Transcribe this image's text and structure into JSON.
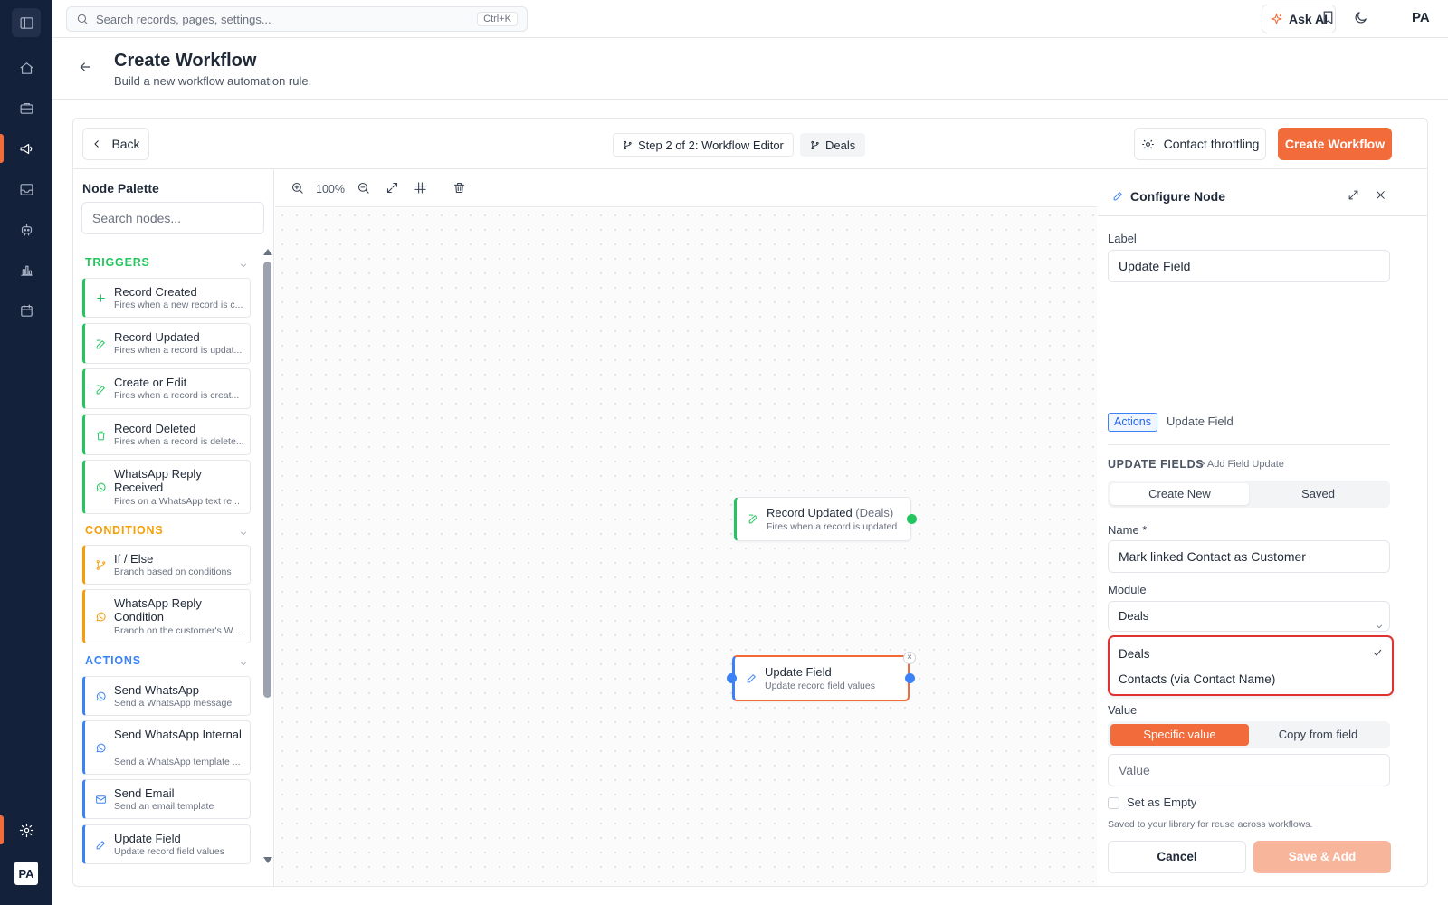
{
  "app": {
    "search_placeholder": "Search records, pages, settings...",
    "search_shortcut": "Ctrl+K",
    "ask_ai_label": "Ask AI",
    "user_initials": "PA",
    "accent_color": "#f26b3a",
    "rail_icons": [
      "sidebar-toggle-icon",
      "home-icon",
      "briefcase-icon",
      "megaphone-icon",
      "inbox-icon",
      "bot-icon",
      "bar-chart-icon",
      "calendar-icon",
      "gear-icon"
    ]
  },
  "page": {
    "title": "Create Workflow",
    "subtitle": "Build a new workflow automation rule."
  },
  "toolbar": {
    "back_label": "Back",
    "step_label": "Step 2 of 2: Workflow Editor",
    "module_label": "Deals",
    "throttling_label": "Contact throttling",
    "create_label": "Create Workflow"
  },
  "palette": {
    "title": "Node Palette",
    "search_placeholder": "Search nodes...",
    "sections": {
      "triggers": {
        "label": "TRIGGERS",
        "color": "#22c55e",
        "items": [
          {
            "title": "Record Created",
            "desc": "Fires when a new record is c...",
            "icon": "plus-icon"
          },
          {
            "title": "Record Updated",
            "desc": "Fires when a record is updat...",
            "icon": "edit-icon"
          },
          {
            "title": "Create or Edit",
            "desc": "Fires when a record is creat...",
            "icon": "edit-icon"
          },
          {
            "title": "Record Deleted",
            "desc": "Fires when a record is delete...",
            "icon": "trash-icon"
          },
          {
            "title": "WhatsApp Reply Received",
            "desc": "Fires on a WhatsApp text re...",
            "icon": "whatsapp-icon"
          }
        ]
      },
      "conditions": {
        "label": "CONDITIONS",
        "color": "#f59e0b",
        "items": [
          {
            "title": "If / Else",
            "desc": "Branch based on conditions",
            "icon": "branch-icon"
          },
          {
            "title": "WhatsApp Reply Condition",
            "desc": "Branch on the customer's W...",
            "icon": "whatsapp-icon"
          }
        ]
      },
      "actions": {
        "label": "ACTIONS",
        "color": "#3b82f6",
        "items": [
          {
            "title": "Send WhatsApp",
            "desc": "Send a WhatsApp message",
            "icon": "whatsapp-icon"
          },
          {
            "title": "Send WhatsApp Internal",
            "desc": "Send a WhatsApp template ...",
            "icon": "whatsapp-icon"
          },
          {
            "title": "Send Email",
            "desc": "Send an email template",
            "icon": "mail-icon"
          },
          {
            "title": "Update Field",
            "desc": "Update record field values",
            "icon": "pencil-icon"
          }
        ]
      }
    }
  },
  "canvas": {
    "zoom_label": "100%",
    "nodes": [
      {
        "title": "Record Updated",
        "suffix": "(Deals)",
        "desc": "Fires when a record is updated"
      },
      {
        "title": "Update Field",
        "desc": "Update record field values",
        "close": "×"
      }
    ]
  },
  "config": {
    "title": "Configure Node",
    "label_field_label": "Label",
    "label_value": "Update Field",
    "tag_category": "Actions",
    "tag_node": "Update Field",
    "update_fields_label": "UPDATE FIELDS",
    "update_fields_crumb": "> Add Field Update",
    "tabs": [
      "Create New",
      "Saved"
    ],
    "name_label": "Name *",
    "name_value": "Mark linked Contact as Customer",
    "module_label": "Module",
    "module_value": "Deals",
    "module_options": [
      "Deals",
      "Contacts (via Contact Name)"
    ],
    "value_label": "Value",
    "value_modes": [
      "Specific value",
      "Copy from field"
    ],
    "value_placeholder": "Value",
    "set_empty_label": "Set as Empty",
    "helper_text": "Saved to your library for reuse across workflows.",
    "cancel_label": "Cancel",
    "save_label": "Save & Add"
  }
}
